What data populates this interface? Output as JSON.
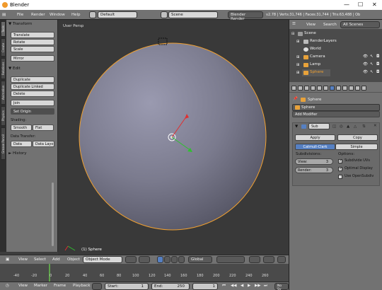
{
  "window": {
    "title": "Blender",
    "minimize": "—",
    "maximize": "☐",
    "close": "✕"
  },
  "info_header": {
    "menus": [
      "File",
      "Render",
      "Window",
      "Help"
    ],
    "screen_layout": "Default",
    "scene": "Scene",
    "render_engine": "Blender Render",
    "stats": "v2.78 | Verts:31,746 | Faces:31,744 | Tris:63,488 | Ob"
  },
  "shelf_tabs": [
    "Tools",
    "Create",
    "Relations",
    "Animation",
    "Physics",
    "Grease Pencil"
  ],
  "tool_shelf": {
    "transform_title": "▼ Transform",
    "translate": "Translate",
    "rotate": "Rotate",
    "scale": "Scale",
    "mirror": "Mirror",
    "edit_title": "▼ Edit",
    "duplicate": "Duplicate",
    "duplicate_linked": "Duplicate Linked",
    "delete": "Delete",
    "join": "Join",
    "set_origin": "Set Origin",
    "shading_title": "Shading:",
    "smooth": "Smooth",
    "flat": "Flat",
    "data_transfer_title": "Data Transfer:",
    "data": "Data",
    "data_layout": "Data Layo",
    "history_title": "► History"
  },
  "viewport": {
    "view_label": "User Persp",
    "object_label": "(1) Sphere"
  },
  "view3d_header": {
    "menus": [
      "View",
      "Select",
      "Add",
      "Object"
    ],
    "mode": "Object Mode",
    "orientation": "Global"
  },
  "timeline": {
    "ticks": [
      "-40",
      "-20",
      "0",
      "20",
      "40",
      "60",
      "80",
      "100",
      "120",
      "140",
      "160",
      "180",
      "200",
      "220",
      "240",
      "260"
    ],
    "menus": [
      "View",
      "Marker",
      "Frame",
      "Playback"
    ],
    "start_label": "Start:",
    "start_value": "1",
    "end_label": "End:",
    "end_value": "250",
    "current_frame": "1",
    "sync": "No Sy"
  },
  "outliner": {
    "view_menu": "View",
    "search_menu": "Search",
    "filter": "All Scenes",
    "items": [
      "Scene",
      "RenderLayers",
      "World",
      "Camera",
      "Lamp",
      "Sphere"
    ]
  },
  "properties": {
    "breadcrumb": "Sphere",
    "object_name": "Sphere",
    "add_modifier": "Add Modifier",
    "modifier_name": "Sub",
    "apply": "Apply",
    "copy": "Copy",
    "catmull_clark": "Catmull-Clark",
    "simple": "Simple",
    "subdivisions_title": "Subdivisions:",
    "options_title": "Options:",
    "view_label": "View:",
    "view_value": "3",
    "render_label": "Render:",
    "render_value": "3",
    "subdivide_uvs": "Subdivide UVs",
    "optimal_display": "Optimal Display",
    "use_opensubdiv": "Use OpenSubdiv"
  },
  "colors": {
    "selection_outline": "#f0a030",
    "axis_x": "#e03030",
    "axis_y": "#30c030",
    "active_blue": "#5680c2"
  }
}
